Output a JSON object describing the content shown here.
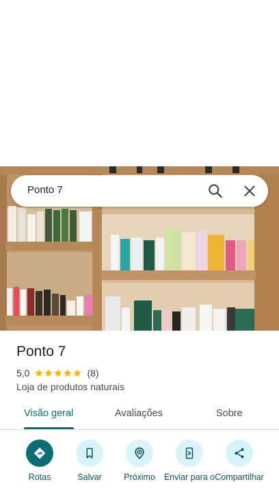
{
  "search": {
    "query": "Ponto 7"
  },
  "place": {
    "name": "Ponto 7",
    "rating": "5,0",
    "stars": 5,
    "review_count": "(8)",
    "category": "Loja de produtos naturais"
  },
  "tabs": [
    {
      "label": "Visão geral",
      "active": true
    },
    {
      "label": "Avaliações",
      "active": false
    },
    {
      "label": "Sobre",
      "active": false
    }
  ],
  "actions": [
    {
      "label": "Rotas",
      "icon": "directions-icon"
    },
    {
      "label": "Salvar",
      "icon": "bookmark-icon"
    },
    {
      "label": "Próximo",
      "icon": "nearby-icon"
    },
    {
      "label": "Enviar para o",
      "icon": "send-to-phone-icon"
    },
    {
      "label": "Compartilhar",
      "icon": "share-icon"
    }
  ],
  "colors": {
    "accent": "#0b6e77",
    "action_bg": "#d9f3fb",
    "star": "#f2b90f"
  }
}
